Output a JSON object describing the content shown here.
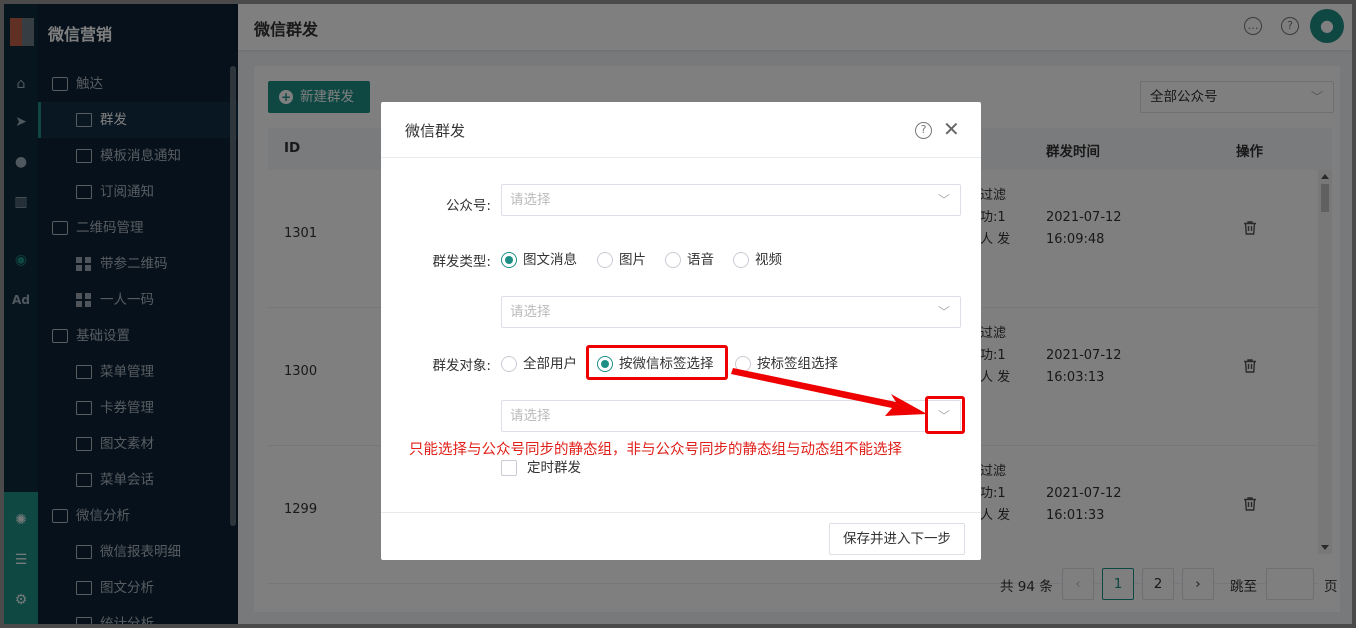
{
  "sidebar": {
    "app_title": "微信营销",
    "items": [
      {
        "label": "触达",
        "level": "group"
      },
      {
        "label": "群发",
        "level": "sub",
        "active": true
      },
      {
        "label": "模板消息通知",
        "level": "sub"
      },
      {
        "label": "订阅通知",
        "level": "sub"
      },
      {
        "label": "二维码管理",
        "level": "group"
      },
      {
        "label": "带参二维码",
        "level": "sub"
      },
      {
        "label": "一人一码",
        "level": "sub"
      },
      {
        "label": "基础设置",
        "level": "group"
      },
      {
        "label": "菜单管理",
        "level": "sub"
      },
      {
        "label": "卡券管理",
        "level": "sub"
      },
      {
        "label": "图文素材",
        "level": "sub"
      },
      {
        "label": "菜单会话",
        "level": "sub"
      },
      {
        "label": "微信分析",
        "level": "group"
      },
      {
        "label": "微信报表明细",
        "level": "sub"
      },
      {
        "label": "图文分析",
        "level": "sub"
      },
      {
        "label": "统计分析",
        "level": "sub"
      }
    ],
    "rail_icons": [
      "home-icon",
      "send-icon",
      "user-icon",
      "bar-chart-icon",
      "wechat-icon",
      "ad-icon",
      "hub-icon",
      "server-icon",
      "gear-icon"
    ],
    "ad_text": "Ad"
  },
  "header": {
    "title": "微信群发",
    "icons": [
      "chat-icon",
      "help-icon",
      "avatar-user-icon"
    ]
  },
  "main": {
    "new_button": "新建群发",
    "account_filter": "全部公众号",
    "table": {
      "headers": [
        "ID",
        "群发时间",
        "操作"
      ],
      "rows": [
        {
          "id": "1301",
          "partial": [
            "过滤",
            "功:1",
            "人 发"
          ],
          "time_date": "2021-07-12",
          "time_clock": "16:09:48"
        },
        {
          "id": "1300",
          "partial": [
            "过滤",
            "功:1",
            "人 发"
          ],
          "time_date": "2021-07-12",
          "time_clock": "16:03:13"
        },
        {
          "id": "1299",
          "partial": [
            "过滤",
            "功:1",
            "人 发"
          ],
          "time_date": "2021-07-12",
          "time_clock": "16:01:33"
        }
      ]
    },
    "pagination": {
      "total": "共 94 条",
      "pages": [
        "1",
        "2"
      ],
      "current": "1",
      "goto_label": "跳至",
      "page_suffix": "页"
    }
  },
  "modal": {
    "title": "微信群发",
    "account_label": "公众号:",
    "account_placeholder": "请选择",
    "type_label": "群发类型:",
    "type_options": [
      "图文消息",
      "图片",
      "语音",
      "视频"
    ],
    "type_selected": "图文消息",
    "content_placeholder": "请选择",
    "target_label": "群发对象:",
    "target_options": [
      "全部用户",
      "按微信标签选择",
      "按标签组选择"
    ],
    "target_selected": "按微信标签选择",
    "tag_placeholder": "请选择",
    "annotation": "只能选择与公众号同步的静态组，非与公众号同步的静态组与动态组不能选择",
    "scheduled_label": "定时群发",
    "save_button": "保存并进入下一步",
    "colors": {
      "accent": "#1f8f86",
      "annotation": "#e0201a"
    }
  }
}
